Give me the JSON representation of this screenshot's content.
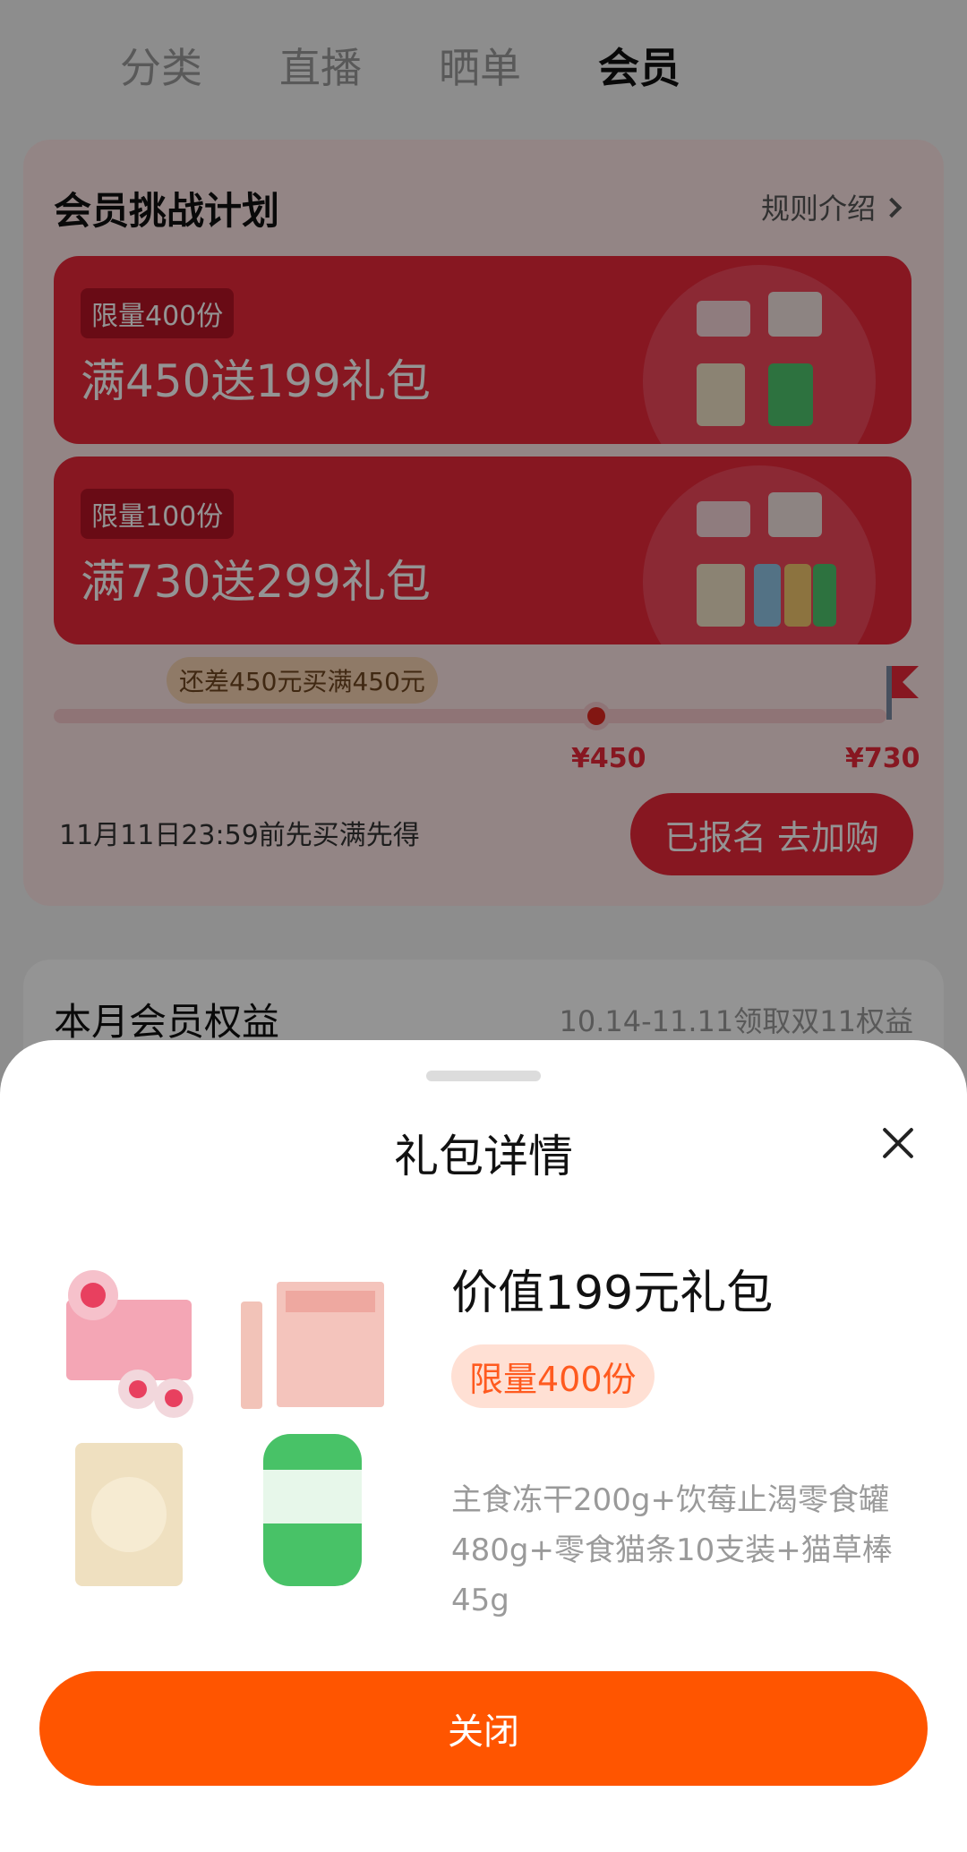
{
  "tabs": [
    "分类",
    "直播",
    "晒单",
    "会员"
  ],
  "challenge": {
    "title": "会员挑战计划",
    "rules_link": "规则介绍",
    "gifts": [
      {
        "limit": "限量400份",
        "title": "满450送199礼包"
      },
      {
        "limit": "限量100份",
        "title": "满730送299礼包"
      }
    ],
    "progress_bubble": "还差450元买满450元",
    "markers": [
      "¥450",
      "¥730"
    ],
    "deadline": "11月11日23:59前先买满先得",
    "cta": "已报名 去加购"
  },
  "benefits": {
    "title": "本月会员权益",
    "date": "10.14-11.11领取双11权益"
  },
  "sheet": {
    "title": "礼包详情",
    "gift_title": "价值199元礼包",
    "limit_tag": "限量400份",
    "description": "主食冻干200g+饮莓止渴零食罐480g+零食猫条10支装+猫草棒45g",
    "close_button": "关闭"
  },
  "colors": {
    "brand_red": "#e8283a",
    "sheet_button": "#ff5500",
    "tag_bg": "#ffe0d4",
    "tag_text": "#ff5a1f"
  }
}
